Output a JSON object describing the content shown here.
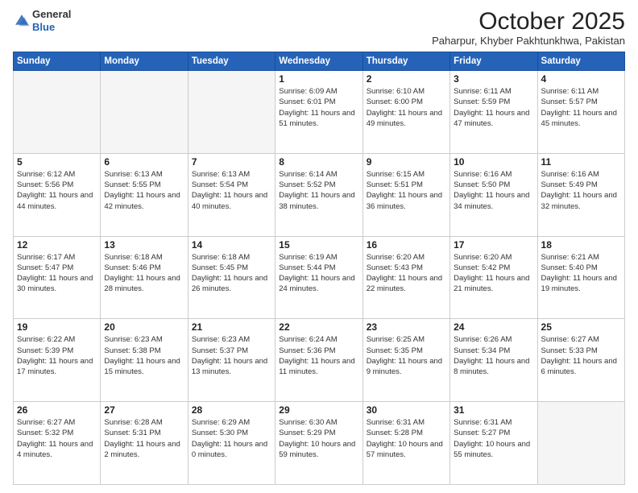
{
  "header": {
    "logo_general": "General",
    "logo_blue": "Blue",
    "month_title": "October 2025",
    "location": "Paharpur, Khyber Pakhtunkhwa, Pakistan"
  },
  "days_of_week": [
    "Sunday",
    "Monday",
    "Tuesday",
    "Wednesday",
    "Thursday",
    "Friday",
    "Saturday"
  ],
  "weeks": [
    [
      {
        "day": "",
        "empty": true
      },
      {
        "day": "",
        "empty": true
      },
      {
        "day": "",
        "empty": true
      },
      {
        "day": "1",
        "sunrise": "Sunrise: 6:09 AM",
        "sunset": "Sunset: 6:01 PM",
        "daylight": "Daylight: 11 hours and 51 minutes."
      },
      {
        "day": "2",
        "sunrise": "Sunrise: 6:10 AM",
        "sunset": "Sunset: 6:00 PM",
        "daylight": "Daylight: 11 hours and 49 minutes."
      },
      {
        "day": "3",
        "sunrise": "Sunrise: 6:11 AM",
        "sunset": "Sunset: 5:59 PM",
        "daylight": "Daylight: 11 hours and 47 minutes."
      },
      {
        "day": "4",
        "sunrise": "Sunrise: 6:11 AM",
        "sunset": "Sunset: 5:57 PM",
        "daylight": "Daylight: 11 hours and 45 minutes."
      }
    ],
    [
      {
        "day": "5",
        "sunrise": "Sunrise: 6:12 AM",
        "sunset": "Sunset: 5:56 PM",
        "daylight": "Daylight: 11 hours and 44 minutes."
      },
      {
        "day": "6",
        "sunrise": "Sunrise: 6:13 AM",
        "sunset": "Sunset: 5:55 PM",
        "daylight": "Daylight: 11 hours and 42 minutes."
      },
      {
        "day": "7",
        "sunrise": "Sunrise: 6:13 AM",
        "sunset": "Sunset: 5:54 PM",
        "daylight": "Daylight: 11 hours and 40 minutes."
      },
      {
        "day": "8",
        "sunrise": "Sunrise: 6:14 AM",
        "sunset": "Sunset: 5:52 PM",
        "daylight": "Daylight: 11 hours and 38 minutes."
      },
      {
        "day": "9",
        "sunrise": "Sunrise: 6:15 AM",
        "sunset": "Sunset: 5:51 PM",
        "daylight": "Daylight: 11 hours and 36 minutes."
      },
      {
        "day": "10",
        "sunrise": "Sunrise: 6:16 AM",
        "sunset": "Sunset: 5:50 PM",
        "daylight": "Daylight: 11 hours and 34 minutes."
      },
      {
        "day": "11",
        "sunrise": "Sunrise: 6:16 AM",
        "sunset": "Sunset: 5:49 PM",
        "daylight": "Daylight: 11 hours and 32 minutes."
      }
    ],
    [
      {
        "day": "12",
        "sunrise": "Sunrise: 6:17 AM",
        "sunset": "Sunset: 5:47 PM",
        "daylight": "Daylight: 11 hours and 30 minutes."
      },
      {
        "day": "13",
        "sunrise": "Sunrise: 6:18 AM",
        "sunset": "Sunset: 5:46 PM",
        "daylight": "Daylight: 11 hours and 28 minutes."
      },
      {
        "day": "14",
        "sunrise": "Sunrise: 6:18 AM",
        "sunset": "Sunset: 5:45 PM",
        "daylight": "Daylight: 11 hours and 26 minutes."
      },
      {
        "day": "15",
        "sunrise": "Sunrise: 6:19 AM",
        "sunset": "Sunset: 5:44 PM",
        "daylight": "Daylight: 11 hours and 24 minutes."
      },
      {
        "day": "16",
        "sunrise": "Sunrise: 6:20 AM",
        "sunset": "Sunset: 5:43 PM",
        "daylight": "Daylight: 11 hours and 22 minutes."
      },
      {
        "day": "17",
        "sunrise": "Sunrise: 6:20 AM",
        "sunset": "Sunset: 5:42 PM",
        "daylight": "Daylight: 11 hours and 21 minutes."
      },
      {
        "day": "18",
        "sunrise": "Sunrise: 6:21 AM",
        "sunset": "Sunset: 5:40 PM",
        "daylight": "Daylight: 11 hours and 19 minutes."
      }
    ],
    [
      {
        "day": "19",
        "sunrise": "Sunrise: 6:22 AM",
        "sunset": "Sunset: 5:39 PM",
        "daylight": "Daylight: 11 hours and 17 minutes."
      },
      {
        "day": "20",
        "sunrise": "Sunrise: 6:23 AM",
        "sunset": "Sunset: 5:38 PM",
        "daylight": "Daylight: 11 hours and 15 minutes."
      },
      {
        "day": "21",
        "sunrise": "Sunrise: 6:23 AM",
        "sunset": "Sunset: 5:37 PM",
        "daylight": "Daylight: 11 hours and 13 minutes."
      },
      {
        "day": "22",
        "sunrise": "Sunrise: 6:24 AM",
        "sunset": "Sunset: 5:36 PM",
        "daylight": "Daylight: 11 hours and 11 minutes."
      },
      {
        "day": "23",
        "sunrise": "Sunrise: 6:25 AM",
        "sunset": "Sunset: 5:35 PM",
        "daylight": "Daylight: 11 hours and 9 minutes."
      },
      {
        "day": "24",
        "sunrise": "Sunrise: 6:26 AM",
        "sunset": "Sunset: 5:34 PM",
        "daylight": "Daylight: 11 hours and 8 minutes."
      },
      {
        "day": "25",
        "sunrise": "Sunrise: 6:27 AM",
        "sunset": "Sunset: 5:33 PM",
        "daylight": "Daylight: 11 hours and 6 minutes."
      }
    ],
    [
      {
        "day": "26",
        "sunrise": "Sunrise: 6:27 AM",
        "sunset": "Sunset: 5:32 PM",
        "daylight": "Daylight: 11 hours and 4 minutes."
      },
      {
        "day": "27",
        "sunrise": "Sunrise: 6:28 AM",
        "sunset": "Sunset: 5:31 PM",
        "daylight": "Daylight: 11 hours and 2 minutes."
      },
      {
        "day": "28",
        "sunrise": "Sunrise: 6:29 AM",
        "sunset": "Sunset: 5:30 PM",
        "daylight": "Daylight: 11 hours and 0 minutes."
      },
      {
        "day": "29",
        "sunrise": "Sunrise: 6:30 AM",
        "sunset": "Sunset: 5:29 PM",
        "daylight": "Daylight: 10 hours and 59 minutes."
      },
      {
        "day": "30",
        "sunrise": "Sunrise: 6:31 AM",
        "sunset": "Sunset: 5:28 PM",
        "daylight": "Daylight: 10 hours and 57 minutes."
      },
      {
        "day": "31",
        "sunrise": "Sunrise: 6:31 AM",
        "sunset": "Sunset: 5:27 PM",
        "daylight": "Daylight: 10 hours and 55 minutes."
      },
      {
        "day": "",
        "empty": true
      }
    ]
  ]
}
